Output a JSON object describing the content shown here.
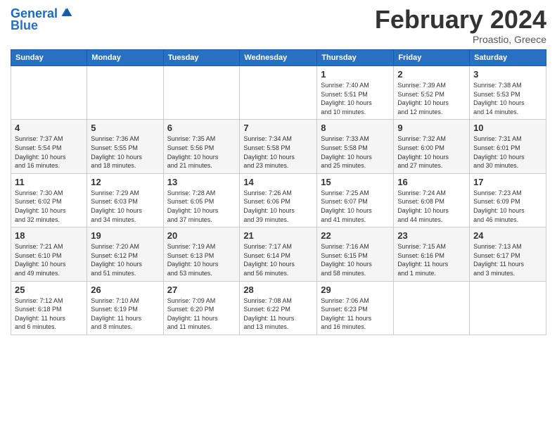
{
  "logo": {
    "line1": "General",
    "line2": "Blue"
  },
  "title": "February 2024",
  "subtitle": "Proastio, Greece",
  "days_of_week": [
    "Sunday",
    "Monday",
    "Tuesday",
    "Wednesday",
    "Thursday",
    "Friday",
    "Saturday"
  ],
  "weeks": [
    [
      {
        "day": "",
        "info": ""
      },
      {
        "day": "",
        "info": ""
      },
      {
        "day": "",
        "info": ""
      },
      {
        "day": "",
        "info": ""
      },
      {
        "day": "1",
        "info": "Sunrise: 7:40 AM\nSunset: 5:51 PM\nDaylight: 10 hours\nand 10 minutes."
      },
      {
        "day": "2",
        "info": "Sunrise: 7:39 AM\nSunset: 5:52 PM\nDaylight: 10 hours\nand 12 minutes."
      },
      {
        "day": "3",
        "info": "Sunrise: 7:38 AM\nSunset: 5:53 PM\nDaylight: 10 hours\nand 14 minutes."
      }
    ],
    [
      {
        "day": "4",
        "info": "Sunrise: 7:37 AM\nSunset: 5:54 PM\nDaylight: 10 hours\nand 16 minutes."
      },
      {
        "day": "5",
        "info": "Sunrise: 7:36 AM\nSunset: 5:55 PM\nDaylight: 10 hours\nand 18 minutes."
      },
      {
        "day": "6",
        "info": "Sunrise: 7:35 AM\nSunset: 5:56 PM\nDaylight: 10 hours\nand 21 minutes."
      },
      {
        "day": "7",
        "info": "Sunrise: 7:34 AM\nSunset: 5:58 PM\nDaylight: 10 hours\nand 23 minutes."
      },
      {
        "day": "8",
        "info": "Sunrise: 7:33 AM\nSunset: 5:58 PM\nDaylight: 10 hours\nand 25 minutes."
      },
      {
        "day": "9",
        "info": "Sunrise: 7:32 AM\nSunset: 6:00 PM\nDaylight: 10 hours\nand 27 minutes."
      },
      {
        "day": "10",
        "info": "Sunrise: 7:31 AM\nSunset: 6:01 PM\nDaylight: 10 hours\nand 30 minutes."
      }
    ],
    [
      {
        "day": "11",
        "info": "Sunrise: 7:30 AM\nSunset: 6:02 PM\nDaylight: 10 hours\nand 32 minutes."
      },
      {
        "day": "12",
        "info": "Sunrise: 7:29 AM\nSunset: 6:03 PM\nDaylight: 10 hours\nand 34 minutes."
      },
      {
        "day": "13",
        "info": "Sunrise: 7:28 AM\nSunset: 6:05 PM\nDaylight: 10 hours\nand 37 minutes."
      },
      {
        "day": "14",
        "info": "Sunrise: 7:26 AM\nSunset: 6:06 PM\nDaylight: 10 hours\nand 39 minutes."
      },
      {
        "day": "15",
        "info": "Sunrise: 7:25 AM\nSunset: 6:07 PM\nDaylight: 10 hours\nand 41 minutes."
      },
      {
        "day": "16",
        "info": "Sunrise: 7:24 AM\nSunset: 6:08 PM\nDaylight: 10 hours\nand 44 minutes."
      },
      {
        "day": "17",
        "info": "Sunrise: 7:23 AM\nSunset: 6:09 PM\nDaylight: 10 hours\nand 46 minutes."
      }
    ],
    [
      {
        "day": "18",
        "info": "Sunrise: 7:21 AM\nSunset: 6:10 PM\nDaylight: 10 hours\nand 49 minutes."
      },
      {
        "day": "19",
        "info": "Sunrise: 7:20 AM\nSunset: 6:12 PM\nDaylight: 10 hours\nand 51 minutes."
      },
      {
        "day": "20",
        "info": "Sunrise: 7:19 AM\nSunset: 6:13 PM\nDaylight: 10 hours\nand 53 minutes."
      },
      {
        "day": "21",
        "info": "Sunrise: 7:17 AM\nSunset: 6:14 PM\nDaylight: 10 hours\nand 56 minutes."
      },
      {
        "day": "22",
        "info": "Sunrise: 7:16 AM\nSunset: 6:15 PM\nDaylight: 10 hours\nand 58 minutes."
      },
      {
        "day": "23",
        "info": "Sunrise: 7:15 AM\nSunset: 6:16 PM\nDaylight: 11 hours\nand 1 minute."
      },
      {
        "day": "24",
        "info": "Sunrise: 7:13 AM\nSunset: 6:17 PM\nDaylight: 11 hours\nand 3 minutes."
      }
    ],
    [
      {
        "day": "25",
        "info": "Sunrise: 7:12 AM\nSunset: 6:18 PM\nDaylight: 11 hours\nand 6 minutes."
      },
      {
        "day": "26",
        "info": "Sunrise: 7:10 AM\nSunset: 6:19 PM\nDaylight: 11 hours\nand 8 minutes."
      },
      {
        "day": "27",
        "info": "Sunrise: 7:09 AM\nSunset: 6:20 PM\nDaylight: 11 hours\nand 11 minutes."
      },
      {
        "day": "28",
        "info": "Sunrise: 7:08 AM\nSunset: 6:22 PM\nDaylight: 11 hours\nand 13 minutes."
      },
      {
        "day": "29",
        "info": "Sunrise: 7:06 AM\nSunset: 6:23 PM\nDaylight: 11 hours\nand 16 minutes."
      },
      {
        "day": "",
        "info": ""
      },
      {
        "day": "",
        "info": ""
      }
    ]
  ]
}
